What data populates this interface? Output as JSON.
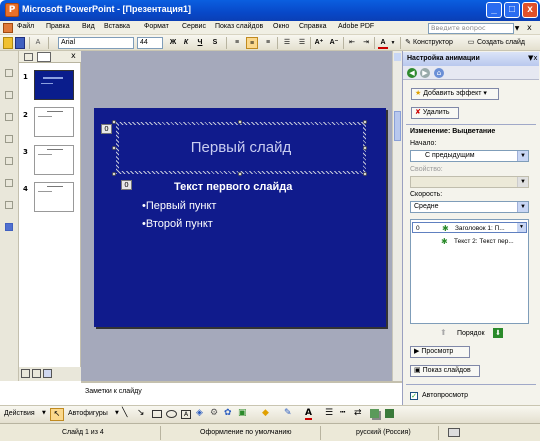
{
  "window": {
    "title": "Microsoft PowerPoint - [Презентация1]",
    "min": "_",
    "max": "□",
    "close": "x"
  },
  "menu": {
    "items": [
      "Файл",
      "Правка",
      "Вид",
      "Вставка",
      "Формат",
      "Сервис",
      "Показ слайдов",
      "Окно",
      "Справка",
      "Adobe PDF"
    ],
    "search_placeholder": "Введите вопрос",
    "close_doc": "x"
  },
  "toolbar": {
    "font": "Arial",
    "font_size": "44",
    "bold": "Ж",
    "italic": "К",
    "underline": "Ч",
    "shadow": "S",
    "grow": "A⁺",
    "shrink": "A⁻",
    "font_color": "A",
    "designer": "Конструктор",
    "new_slide": "Создать слайд"
  },
  "slides": [
    {
      "num": "1"
    },
    {
      "num": "2"
    },
    {
      "num": "3"
    },
    {
      "num": "4"
    }
  ],
  "slide": {
    "title": "Первый слайд",
    "title_badge": "0",
    "body_badge": "0",
    "body_title": "Текст первого слайда",
    "bullets": [
      "•Первый пункт",
      "•Второй пункт"
    ]
  },
  "notes": {
    "placeholder": "Заметки к слайду"
  },
  "pane": {
    "title": "Настройка анимации",
    "add_effect": "Добавить эффект",
    "remove": "Удалить",
    "change_label": "Изменение: Выцветание",
    "start_label": "Начало:",
    "start_value": "С предыдущим",
    "property_label": "Свойство:",
    "property_value": "",
    "speed_label": "Скорость:",
    "speed_value": "Средне",
    "anim_items": [
      {
        "index": "0",
        "text": "Заголовок 1: П..."
      },
      {
        "index": "",
        "text": "Текст 2: Текст пер..."
      }
    ],
    "order_label": "Порядок",
    "preview": "Просмотр",
    "slideshow": "Показ слайдов",
    "autopreview": "Автопросмотр"
  },
  "drawing": {
    "actions": "Действия",
    "autoshapes": "Автофигуры"
  },
  "status": {
    "slide": "Слайд 1 из 4",
    "design": "Оформление по умолчанию",
    "lang": "русский (Россия)"
  },
  "colors": {
    "slide_bg": "#101b8c",
    "title_bar": "#0848c8",
    "pane_bg": "#f4f3ec"
  }
}
